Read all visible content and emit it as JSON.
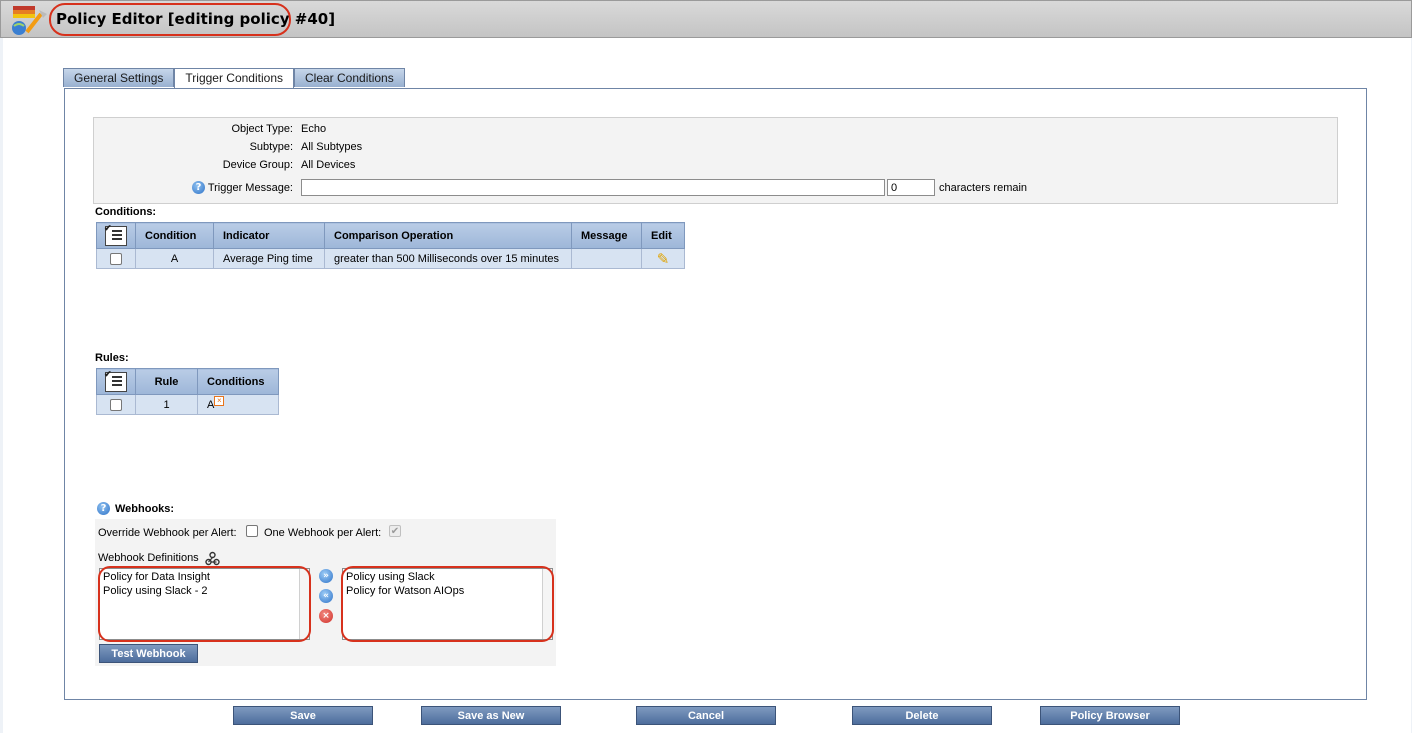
{
  "window": {
    "title": "Policy Editor [editing policy #40]"
  },
  "tabs": [
    {
      "label": "General Settings"
    },
    {
      "label": "Trigger Conditions"
    },
    {
      "label": "Clear Conditions"
    }
  ],
  "active_tab": "Trigger Conditions",
  "info": {
    "object_type_label": "Object Type:",
    "object_type_value": "Echo",
    "subtype_label": "Subtype:",
    "subtype_value": "All Subtypes",
    "device_group_label": "Device Group:",
    "device_group_value": "All Devices",
    "trigger_message_label": "Trigger Message:",
    "trigger_message_value": "",
    "char_count": "0",
    "characters_remain": "characters remain"
  },
  "conditions": {
    "label": "Conditions:",
    "headers": [
      "Condition",
      "Indicator",
      "Comparison Operation",
      "Message",
      "Edit"
    ],
    "rows": [
      {
        "condition": "A",
        "indicator": "Average Ping time",
        "comparison": "greater than 500 Milliseconds over 15 minutes",
        "message": ""
      }
    ]
  },
  "rules": {
    "label": "Rules:",
    "headers": [
      "Rule",
      "Conditions"
    ],
    "rows": [
      {
        "rule": "1",
        "conditions": "A"
      }
    ]
  },
  "webhooks": {
    "label": "Webhooks:",
    "override_label": "Override Webhook per Alert:",
    "override_checked": false,
    "one_label": "One Webhook per Alert:",
    "one_checked": true,
    "definitions_label": "Webhook Definitions",
    "available": [
      "Policy for Data Insight",
      "Policy using Slack - 2"
    ],
    "selected": [
      "Policy using Slack",
      "Policy for Watson AIOps"
    ],
    "test_button": "Test Webhook"
  },
  "footer_buttons": {
    "save": "Save",
    "save_as_new": "Save as New",
    "cancel": "Cancel",
    "delete": "Delete",
    "policy_browser": "Policy Browser"
  },
  "colors": {
    "accent": "#4d6d9c",
    "annotation": "#d7311c",
    "row_bg": "#d7e3f2",
    "header_bg": "#b9cce6"
  },
  "icons": {
    "app": "policy-editor-icon",
    "help": "help-icon",
    "edit": "pencil-icon",
    "remove": "remove-x-icon",
    "webhook": "webhook-icon"
  }
}
